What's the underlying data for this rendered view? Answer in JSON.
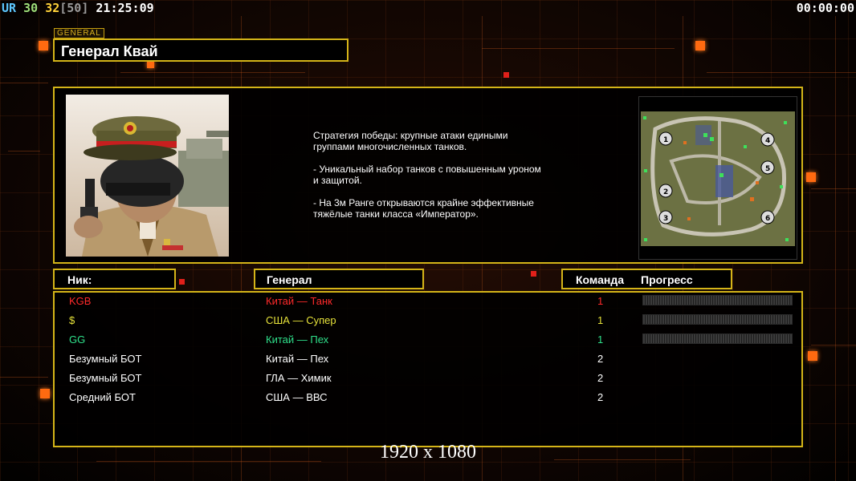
{
  "hud": {
    "ur_label": "UR",
    "stat1": "30",
    "stat2": "32",
    "stat3": "[50]",
    "clock": "21:25:09",
    "timer": "00:00:00"
  },
  "general": {
    "tag": "GENERAL",
    "name": "Генерал Квай",
    "description": [
      "Стратегия победы: крупные атаки едиными\n группами многочисленных танков.",
      "- Уникальный набор танков с повышенным уроном\n и защитой.",
      "- На 3м Ранге открываются крайне эффективные\n тяжёлые танки класса «Император»."
    ]
  },
  "minimap": {
    "spawn_labels": [
      "1",
      "2",
      "3",
      "4",
      "5",
      "6"
    ]
  },
  "table": {
    "headers": {
      "nick": "Ник:",
      "general": "Генерал",
      "team": "Команда",
      "progress": "Прогресс"
    },
    "rows": [
      {
        "nick": "KGB",
        "general": "Китай — Танк",
        "team": "1",
        "color": "#ff2a2a",
        "progress": 0
      },
      {
        "nick": "$",
        "general": "США — Супер",
        "team": "1",
        "color": "#e6e23a",
        "progress": 0
      },
      {
        "nick": "GG",
        "general": "Китай — Пех",
        "team": "1",
        "color": "#2fe08a",
        "progress": 0
      },
      {
        "nick": "Безумный БОТ",
        "general": "Китай — Пех",
        "team": "2",
        "color": "#ffffff"
      },
      {
        "nick": "Безумный БОТ",
        "general": "ГЛА — Химик",
        "team": "2",
        "color": "#ffffff"
      },
      {
        "nick": "Средний БОТ",
        "general": "США — ВВС",
        "team": "2",
        "color": "#ffffff"
      }
    ]
  },
  "resolution": "1920 x 1080"
}
